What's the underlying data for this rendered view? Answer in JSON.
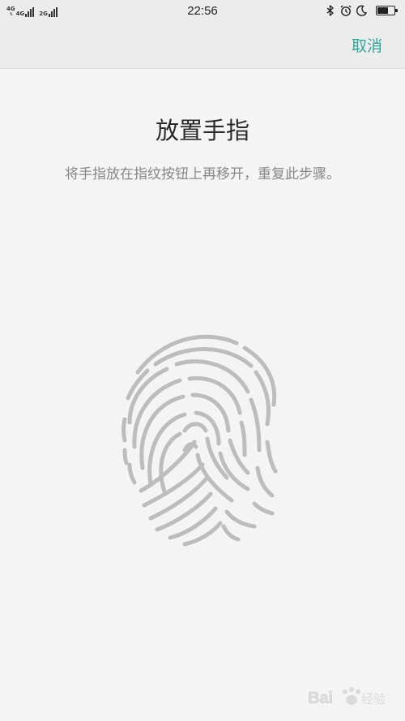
{
  "status_bar": {
    "network_1": "4G",
    "network_2": "4G",
    "network_3": "2G",
    "time": "22:56",
    "battery_percent": 65,
    "icons": [
      "bluetooth-icon",
      "alarm-icon",
      "moon-icon"
    ]
  },
  "header": {
    "cancel_label": "取消"
  },
  "main": {
    "title": "放置手指",
    "instruction": "将手指放在指纹按钮上再移开，重复此步骤。",
    "icon": "fingerprint-icon"
  },
  "colors": {
    "accent": "#2aa896",
    "fingerprint": "#bdbdbd",
    "background": "#f4f4f4"
  }
}
